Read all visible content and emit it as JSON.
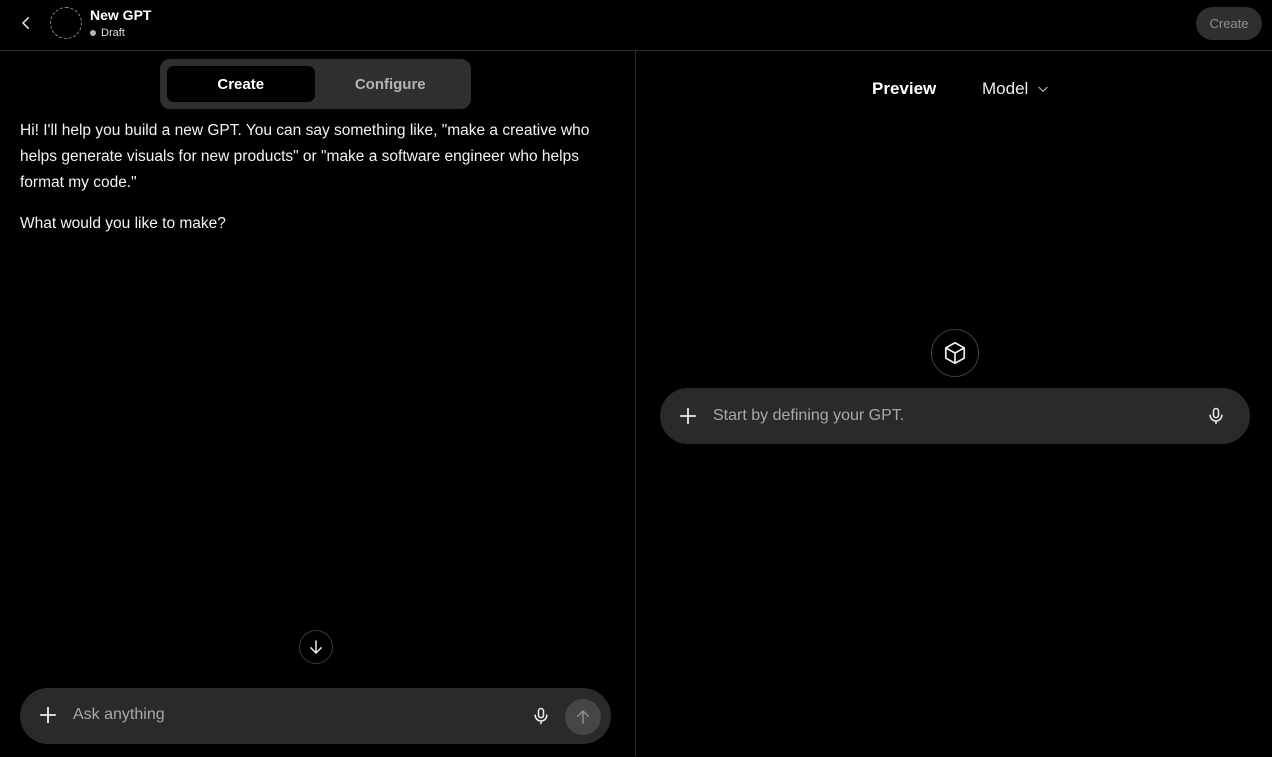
{
  "header": {
    "gpt_name": "New GPT",
    "status": "Draft",
    "create_button": "Create"
  },
  "builder": {
    "tabs": [
      {
        "label": "Create",
        "active": true
      },
      {
        "label": "Configure",
        "active": false
      }
    ],
    "messages": [
      "Hi! I'll help you build a new GPT. You can say something like, \"make a creative who helps generate visuals for new products\" or \"make a software engineer who helps format my code.\"",
      "What would you like to make?"
    ],
    "composer_placeholder": "Ask anything"
  },
  "preview": {
    "title": "Preview",
    "model_label": "Model",
    "composer_placeholder": "Start by defining your GPT."
  },
  "icons": {
    "back": "chevron-left-icon",
    "plus": "plus-icon",
    "mic": "microphone-icon",
    "send": "arrow-up-icon",
    "scroll": "arrow-down-icon",
    "cube": "cube-icon",
    "dropdown": "chevron-down-icon"
  },
  "colors": {
    "background": "#000000",
    "composer": "#2a2a2a",
    "segmented": "#2f2f2f",
    "text": "#ececec",
    "muted": "#a8a8a8"
  }
}
